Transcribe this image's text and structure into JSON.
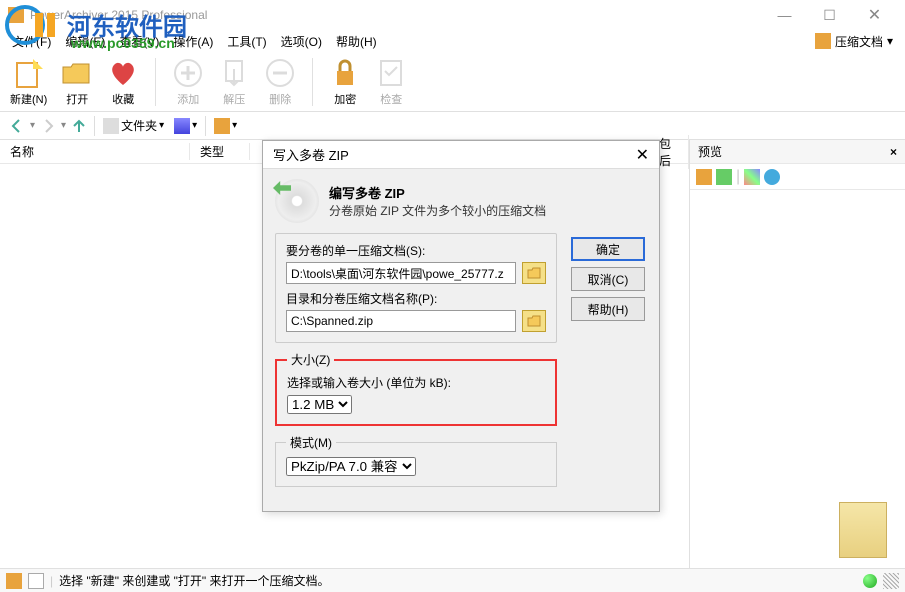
{
  "titlebar": {
    "title": "PowerArchiver 2015 Professional"
  },
  "menubar": {
    "items": [
      "文件(F)",
      "编辑(E)",
      "查看(V)",
      "操作(A)",
      "工具(T)",
      "选项(O)",
      "帮助(H)"
    ],
    "right_label": "压缩文档"
  },
  "toolbar": {
    "new": "新建(N)",
    "open": "打开",
    "favorite": "收藏",
    "add": "添加",
    "extract": "解压",
    "delete": "删除",
    "encrypt": "加密",
    "check": "检查"
  },
  "navbar": {
    "folders": "文件夹"
  },
  "listview": {
    "columns": {
      "name": "名称",
      "type": "类型",
      "after": "包后"
    }
  },
  "preview": {
    "title": "预览"
  },
  "statusbar": {
    "hint": "选择 \"新建\" 来创建或 \"打开\" 来打开一个压缩文档。"
  },
  "dialog": {
    "title": "写入多卷 ZIP",
    "header_title": "编写多卷 ZIP",
    "header_sub": "分卷原始 ZIP 文件为多个较小的压缩文档",
    "source_label": "要分卷的单一压缩文档(S):",
    "source_value": "D:\\tools\\桌面\\河东软件园\\powe_25777.z",
    "dest_label": "目录和分卷压缩文档名称(P):",
    "dest_value": "C:\\Spanned.zip",
    "size_legend": "大小(Z)",
    "size_label": "选择或输入卷大小 (单位为 kB):",
    "size_value": "1.2 MB",
    "mode_legend": "模式(M)",
    "mode_value": "PkZip/PA 7.0 兼容",
    "btn_ok": "确定",
    "btn_cancel": "取消(C)",
    "btn_help": "帮助(H)"
  },
  "watermark": {
    "text": "河东软件园",
    "url": "www.pc0359.cn"
  }
}
